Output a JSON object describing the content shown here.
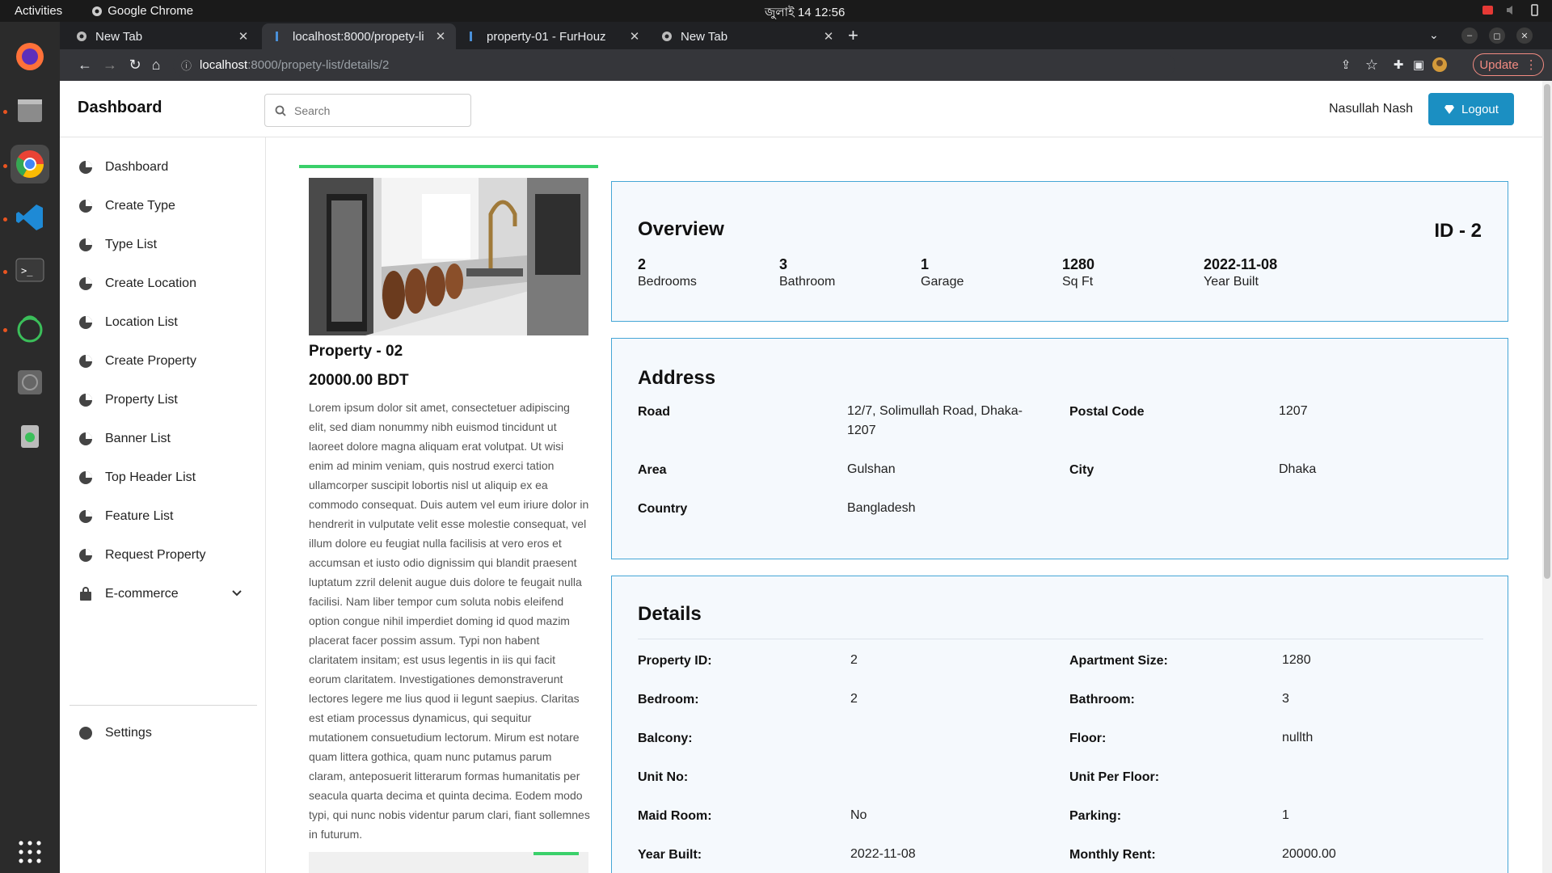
{
  "system": {
    "activities": "Activities",
    "app_name": "Google Chrome",
    "clock": "জুলাই 14  12:56"
  },
  "browser": {
    "tabs": [
      {
        "title": "New Tab"
      },
      {
        "title": "localhost:8000/propety-li"
      },
      {
        "title": "property-01 - FurHouz"
      },
      {
        "title": "New Tab"
      }
    ],
    "url_host": "localhost",
    "url_path": ":8000/propety-list/details/2",
    "update_label": "Update"
  },
  "header": {
    "brand": "Dashboard",
    "search_placeholder": "Search",
    "username": "Nasullah Nash",
    "logout_label": "Logout"
  },
  "sidebar": {
    "items": [
      {
        "label": "Dashboard"
      },
      {
        "label": "Create Type"
      },
      {
        "label": "Type List"
      },
      {
        "label": "Create Location"
      },
      {
        "label": "Location List"
      },
      {
        "label": "Create Property"
      },
      {
        "label": "Property List"
      },
      {
        "label": "Banner List"
      },
      {
        "label": "Top Header List"
      },
      {
        "label": "Feature List"
      },
      {
        "label": "Request Property"
      },
      {
        "label": "E-commerce"
      }
    ],
    "settings_label": "Settings"
  },
  "property": {
    "name": "Property - 02",
    "price": "20000.00 BDT",
    "description": "Lorem ipsum dolor sit amet, consectetuer adipiscing elit, sed diam nonummy nibh euismod tincidunt ut laoreet dolore magna aliquam erat volutpat. Ut wisi enim ad minim veniam, quis nostrud exerci tation ullamcorper suscipit lobortis nisl ut aliquip ex ea commodo consequat. Duis autem vel eum iriure dolor in hendrerit in vulputate velit esse molestie consequat, vel illum dolore eu feugiat nulla facilisis at vero eros et accumsan et iusto odio dignissim qui blandit praesent luptatum zzril delenit augue duis dolore te feugait nulla facilisi. Nam liber tempor cum soluta nobis eleifend option congue nihil imperdiet doming id quod mazim placerat facer possim assum. Typi non habent claritatem insitam; est usus legentis in iis qui facit eorum claritatem. Investigationes demonstraverunt lectores legere me lius quod ii legunt saepius. Claritas est etiam processus dynamicus, qui sequitur mutationem consuetudium lectorum. Mirum est notare quam littera gothica, quam nunc putamus parum claram, anteposuerit litterarum formas humanitatis per seacula quarta decima et quinta decima. Eodem modo typi, qui nunc nobis videntur parum clari, fiant sollemnes in futurum."
  },
  "overview": {
    "title": "Overview",
    "id_label": "ID - 2",
    "stats": [
      {
        "value": "2",
        "label": "Bedrooms"
      },
      {
        "value": "3",
        "label": "Bathroom"
      },
      {
        "value": "1",
        "label": "Garage"
      },
      {
        "value": "1280",
        "label": "Sq Ft"
      },
      {
        "value": "2022-11-08",
        "label": "Year Built"
      }
    ]
  },
  "address": {
    "title": "Address",
    "road_label": "Road",
    "road": "12/7, Solimullah Road, Dhaka-1207",
    "postal_label": "Postal Code",
    "postal": "1207",
    "area_label": "Area",
    "area": "Gulshan",
    "city_label": "City",
    "city": "Dhaka",
    "country_label": "Country",
    "country": "Bangladesh"
  },
  "details": {
    "title": "Details",
    "rows": [
      {
        "l1": "Property ID:",
        "v1": "2",
        "l2": "Apartment Size:",
        "v2": "1280"
      },
      {
        "l1": "Bedroom:",
        "v1": "2",
        "l2": "Bathroom:",
        "v2": "3"
      },
      {
        "l1": "Balcony:",
        "v1": "",
        "l2": "Floor:",
        "v2": "nullth"
      },
      {
        "l1": "Unit No:",
        "v1": "",
        "l2": "Unit Per Floor:",
        "v2": ""
      },
      {
        "l1": "Maid Room:",
        "v1": "No",
        "l2": "Parking:",
        "v2": "1"
      },
      {
        "l1": "Year Built:",
        "v1": "2022-11-08",
        "l2": "Monthly Rent:",
        "v2": "20000.00"
      }
    ]
  },
  "colors": {
    "primary": "#1b8fc2",
    "panel_border": "#45a6d6",
    "accent_green": "#3ad06a"
  }
}
